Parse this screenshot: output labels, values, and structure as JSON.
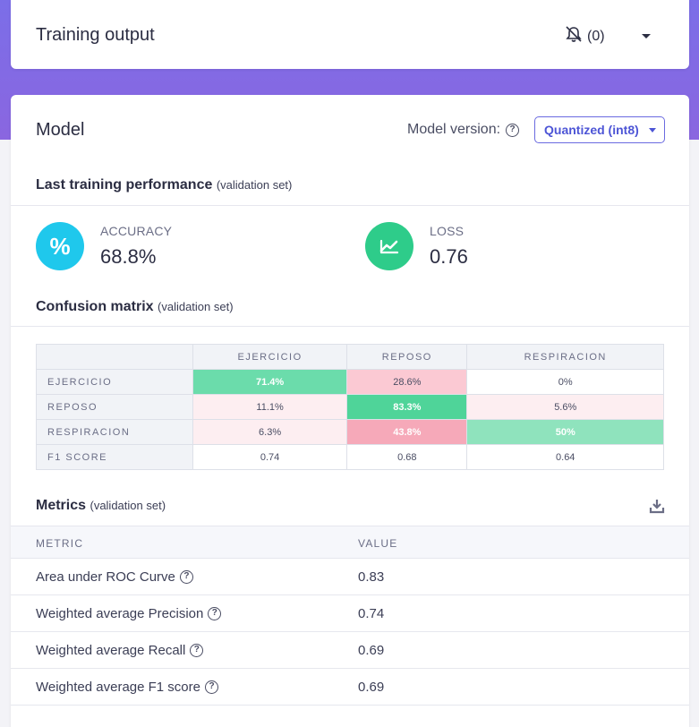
{
  "header": {
    "title": "Training output",
    "notifications_count": "(0)"
  },
  "model": {
    "title": "Model",
    "version_label": "Model version:",
    "version_value": "Quantized (int8)"
  },
  "performance": {
    "title": "Last training performance",
    "subtitle": "(validation set)",
    "accuracy_label": "ACCURACY",
    "accuracy_value": "68.8%",
    "accuracy_icon": "%",
    "loss_label": "LOSS",
    "loss_value": "0.76"
  },
  "confusion": {
    "title": "Confusion matrix",
    "subtitle": "(validation set)",
    "columns": [
      "EJERCICIO",
      "REPOSO",
      "RESPIRACION"
    ],
    "rows": [
      {
        "label": "EJERCICIO",
        "cells": [
          "71.4%",
          "28.6%",
          "0%"
        ]
      },
      {
        "label": "REPOSO",
        "cells": [
          "11.1%",
          "83.3%",
          "5.6%"
        ]
      },
      {
        "label": "RESPIRACION",
        "cells": [
          "6.3%",
          "43.8%",
          "50%"
        ]
      },
      {
        "label": "F1 SCORE",
        "cells": [
          "0.74",
          "0.68",
          "0.64"
        ]
      }
    ]
  },
  "metrics": {
    "title": "Metrics",
    "subtitle": "(validation set)",
    "col_metric": "METRIC",
    "col_value": "VALUE",
    "rows": [
      {
        "name": "Area under ROC Curve",
        "value": "0.83"
      },
      {
        "name": "Weighted average Precision",
        "value": "0.74"
      },
      {
        "name": "Weighted average Recall",
        "value": "0.69"
      },
      {
        "name": "Weighted average F1 score",
        "value": "0.69"
      }
    ]
  },
  "colors": {
    "accent": "#4d55d6",
    "accuracy_icon_bg": "#1fc8ec",
    "loss_icon_bg": "#2ecc8a",
    "green_strong": "#4fd499",
    "green_mid": "#6bdcab",
    "green_light": "#8fe3bd",
    "pink_strong": "#f6a9b9",
    "pink_mid": "#fbc9d3",
    "pink_light": "#fdeef1"
  }
}
